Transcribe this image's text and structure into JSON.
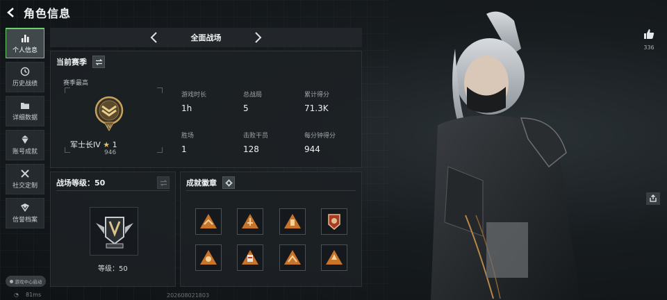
{
  "header": {
    "title": "角色信息"
  },
  "sidebar": {
    "items": [
      {
        "label": "个人信息",
        "icon": "bar-chart-icon",
        "active": true
      },
      {
        "label": "历史战绩",
        "icon": "history-icon",
        "active": false
      },
      {
        "label": "详细数据",
        "icon": "folder-icon",
        "active": false
      },
      {
        "label": "账号成就",
        "icon": "achievement-icon",
        "active": false
      },
      {
        "label": "社交定制",
        "icon": "tools-icon",
        "active": false
      },
      {
        "label": "信誉档案",
        "icon": "reputation-icon",
        "active": false
      }
    ],
    "game_center": "游戏中心启动"
  },
  "mode": {
    "label": "全面战场"
  },
  "season": {
    "title": "当前赛季",
    "best_label": "赛季最高",
    "rank_name": "军士长IV",
    "stars": "1",
    "rank_points": "946",
    "stats": [
      {
        "label": "游戏时长",
        "value": "1h"
      },
      {
        "label": "总战局",
        "value": "5"
      },
      {
        "label": "累计得分",
        "value": "71.3K"
      },
      {
        "label": "胜场",
        "value": "1"
      },
      {
        "label": "击败干员",
        "value": "128"
      },
      {
        "label": "每分钟得分",
        "value": "944"
      }
    ]
  },
  "level": {
    "title": "战场等级：50",
    "level_text": "等级：50"
  },
  "achievements": {
    "title": "成就徽章",
    "badges": [
      "badge-1",
      "badge-2",
      "badge-3",
      "badge-4",
      "badge-5",
      "badge-6",
      "badge-7",
      "badge-8"
    ]
  },
  "likes": {
    "count": "336"
  },
  "footer": {
    "ping": "81ms",
    "uid": "202608021803"
  },
  "colors": {
    "accent": "#6bd06b",
    "gold": "#c9a35b",
    "badge_orange": "#c8742a"
  }
}
